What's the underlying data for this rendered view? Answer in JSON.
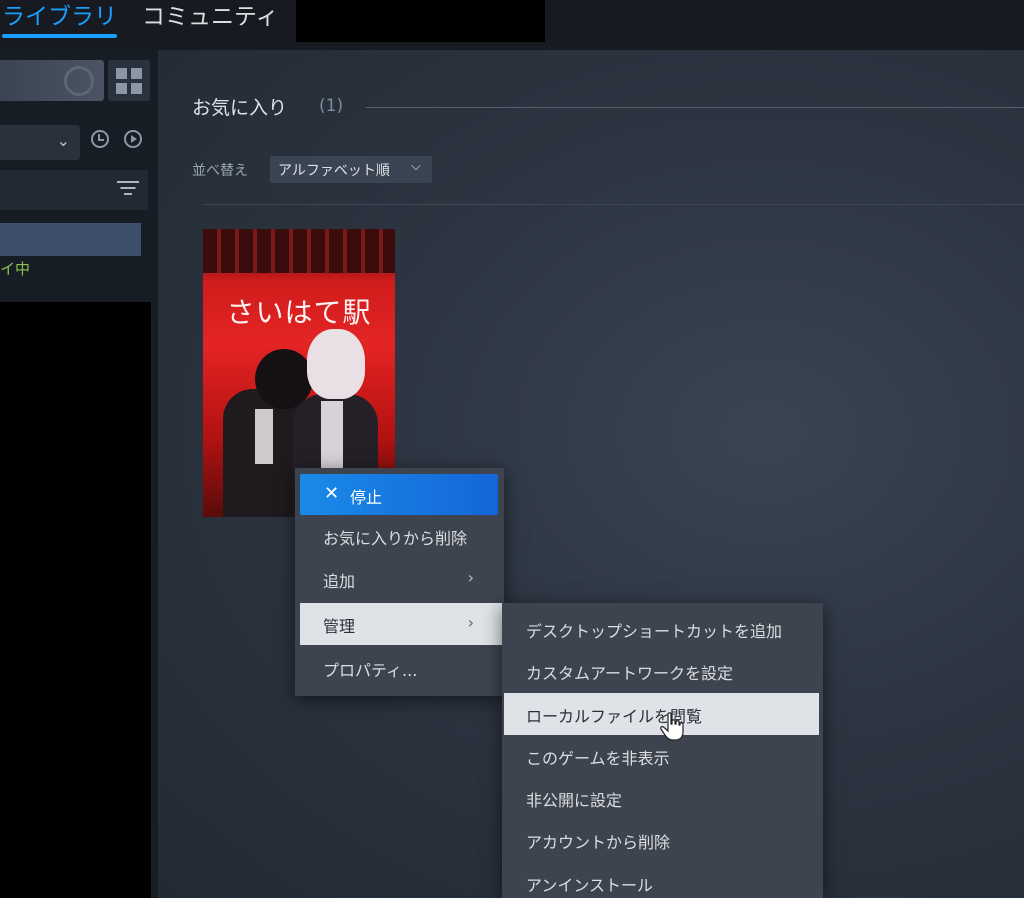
{
  "topnav": {
    "tabs": [
      {
        "label": "ライブラリ",
        "active": true
      },
      {
        "label": "コミュニティ",
        "active": false
      }
    ],
    "accent_color": "#1a9fff"
  },
  "sidebar": {
    "game_status": "プレイ中",
    "status_color": "#8ec24f"
  },
  "main": {
    "shelf": {
      "title": "お気に入り",
      "count": "(1)"
    },
    "sort": {
      "label": "並べ替え",
      "value": "アルファベット順"
    },
    "game": {
      "capsule_title": "さいはて駅"
    }
  },
  "context_menu": {
    "items": [
      {
        "label": "停止",
        "icon": "close-icon",
        "highlighted": true
      },
      {
        "label": "お気に入りから削除"
      },
      {
        "label": "追加",
        "has_submenu": true
      },
      {
        "label": "管理",
        "has_submenu": true,
        "hovered": true
      },
      {
        "label": "プロパティ..."
      }
    ]
  },
  "submenu": {
    "items": [
      {
        "label": "デスクトップショートカットを追加"
      },
      {
        "label": "カスタムアートワークを設定"
      },
      {
        "label": "ローカルファイルを閲覧",
        "hovered": true
      },
      {
        "label": "このゲームを非表示"
      },
      {
        "label": "非公開に設定"
      },
      {
        "label": "アカウントから削除"
      },
      {
        "label": "アンインストール"
      }
    ]
  }
}
